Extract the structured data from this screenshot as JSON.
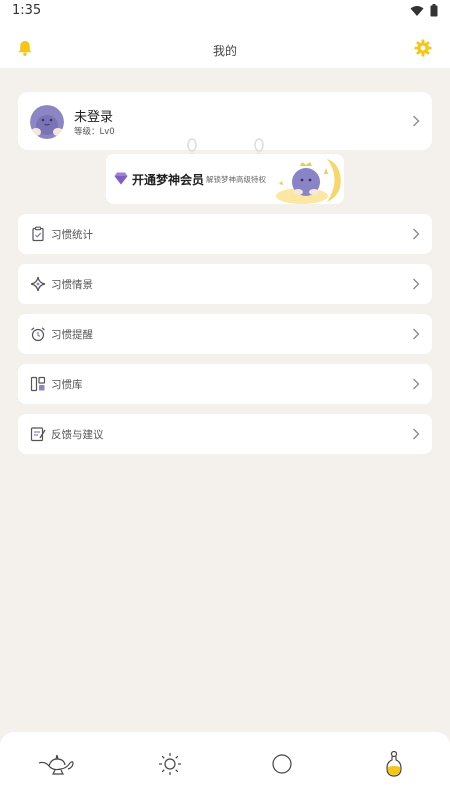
{
  "status_bar": {
    "time": "1:35"
  },
  "header": {
    "title": "我的"
  },
  "profile": {
    "name": "未登录",
    "level": "等级：Lv0"
  },
  "vip": {
    "title": "开通梦神会员",
    "subtitle": "解锁梦神高级特权"
  },
  "menu": [
    {
      "label": "习惯统计",
      "icon": "clipboard-icon"
    },
    {
      "label": "习惯情景",
      "icon": "sparkle-icon"
    },
    {
      "label": "习惯提醒",
      "icon": "alarm-clock-icon"
    },
    {
      "label": "习惯库",
      "icon": "library-icon"
    },
    {
      "label": "反馈与建议",
      "icon": "feedback-icon"
    }
  ],
  "bottom_nav": [
    {
      "icon": "magic-lamp-icon"
    },
    {
      "icon": "sun-icon"
    },
    {
      "icon": "circle-icon"
    },
    {
      "icon": "potion-bottle-icon",
      "active": true
    }
  ],
  "colors": {
    "accent": "#f5c518",
    "avatar": "#8c86c4",
    "background": "#f4f1ec"
  }
}
